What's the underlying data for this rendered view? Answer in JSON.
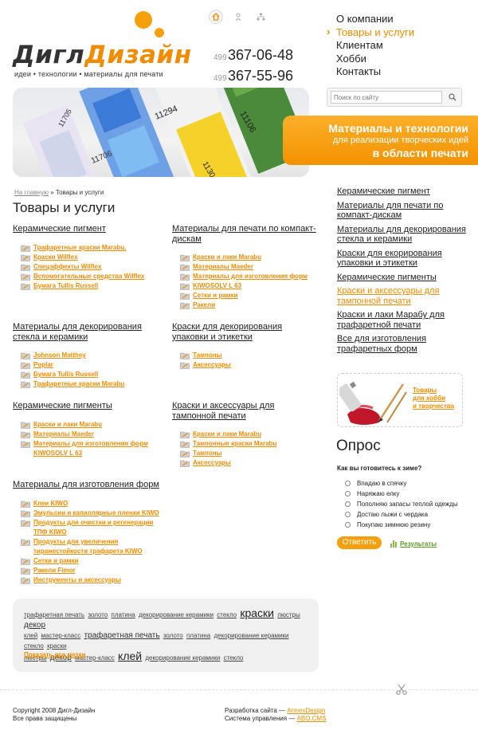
{
  "logo": {
    "part1": "Дигл",
    "part2": "Дизайн",
    "tagline": "идеи • технологии • материалы для печати"
  },
  "top_icons": [
    "home-icon",
    "person-icon",
    "sitemap-icon"
  ],
  "phones": [
    {
      "code": "499",
      "number": "367-06-48"
    },
    {
      "code": "499",
      "number": "367-55-96"
    }
  ],
  "top_nav": [
    {
      "label": "О компании",
      "active": false
    },
    {
      "label": "Товары и услуги",
      "active": true
    },
    {
      "label": "Клиентам",
      "active": false
    },
    {
      "label": "Хобби",
      "active": false
    },
    {
      "label": "Контакты",
      "active": false
    }
  ],
  "search": {
    "placeholder": "Поиск по сайту"
  },
  "banner": {
    "line1": "Материалы и технологии",
    "line2": "для реализации творческих идей",
    "line3": "в области печати",
    "swatch_labels": [
      "11705",
      "11294",
      "11106",
      "11706",
      "1130"
    ]
  },
  "breadcrumb": {
    "home": "На главную",
    "sep": "»",
    "current": "Товары и услуги"
  },
  "page_title": "Товары и услуги",
  "sections": [
    {
      "title": "Керамические пигмент",
      "items": [
        "Трафаретные краски Marabu.",
        "Краски Wilflex",
        "Спецэффекты Wilflex",
        "Вспомогательные средства Wilflex",
        "Бумага Tullis Russell"
      ]
    },
    {
      "title": "Материалы для печати по компакт-дискам",
      "items": [
        "Краски и лаки Marabu",
        "Материалы Maeder",
        "Материалы для изготовления форм",
        "KIWOSOLV L 63",
        "Сетки и рамки",
        "Ракели"
      ]
    },
    {
      "title": "Материалы для декорирования стекла и керамики",
      "items": [
        "Johnson Matthey",
        "Poplar",
        "Бумага Tullis Russell",
        "Трафаретные краски Marabu"
      ]
    },
    {
      "title": "Краски для декорирования упаковки и этикетки",
      "items": [
        "Тампоны",
        "Аксессуары"
      ]
    },
    {
      "title": "Керамические пигменты",
      "items": [
        "Краски и лаки Marabu",
        "Материалы Maeder",
        "Материалы для изготовления форм KIWOSOLV L 63"
      ]
    },
    {
      "title": "Краски и аксессуары для тампонной печати",
      "items": [
        "Краски и лаки Marabu",
        "Тампонные краски Marabu",
        "Тампоны",
        "Аксессуары"
      ]
    },
    {
      "title": "Материалы для изготовления форм",
      "items": [
        "Клеи KIWO",
        "Эмульсии и капиллярные пленки KIWO",
        "Продукты для очистки и регенерации ТПФ KIWO",
        "Продукты для увеличения тиражестойкости трафарета KIWO",
        "Сетки и рамки",
        "Ракели Fimor",
        "Инструменты и аксессуары"
      ]
    }
  ],
  "tags": {
    "row1": [
      {
        "text": "трафаретная печать",
        "size": "sm"
      },
      {
        "text": "золото",
        "size": "sm"
      },
      {
        "text": "платина",
        "size": "sm"
      },
      {
        "text": "декорирование керамики",
        "size": "sm"
      },
      {
        "text": "стекло",
        "size": "sm"
      },
      {
        "text": "краски",
        "size": "lg"
      },
      {
        "text": "люстры",
        "size": "sm"
      },
      {
        "text": "декор",
        "size": "md"
      }
    ],
    "row2": [
      {
        "text": "клей",
        "size": "sm"
      },
      {
        "text": "мастер-класс",
        "size": "sm"
      },
      {
        "text": "трафаретная печать",
        "size": "md"
      },
      {
        "text": "золото",
        "size": "sm"
      },
      {
        "text": "платина",
        "size": "sm"
      },
      {
        "text": "декорирование керамики",
        "size": "sm"
      },
      {
        "text": "стекло",
        "size": "sm"
      },
      {
        "text": "краски",
        "size": "sm"
      }
    ],
    "row3": [
      {
        "text": "люстры",
        "size": "sm"
      },
      {
        "text": "декор",
        "size": "md"
      },
      {
        "text": "мастер-класс",
        "size": "sm"
      },
      {
        "text": "клей",
        "size": "lg"
      },
      {
        "text": "декорирование керамики",
        "size": "sm"
      },
      {
        "text": "стекло",
        "size": "sm"
      }
    ],
    "show_all": "Показать все метки"
  },
  "side_nav": [
    {
      "label": "Керамические пигмент",
      "active": false
    },
    {
      "label": "Материалы для печати по компакт-дискам",
      "active": false
    },
    {
      "label": "Материалы для декорирования стекла и керамики",
      "active": false
    },
    {
      "label": "Краски для екорирования упаковки и этикетки",
      "active": false
    },
    {
      "label": "Керамические пигменты",
      "active": false
    },
    {
      "label": "Краски и аксессуары для тампонной печати",
      "active": true
    },
    {
      "label": "Краски и лаки Марабу для трафаретной печати",
      "active": false
    },
    {
      "label": "Все для изготовления трафаретных форм",
      "active": false
    }
  ],
  "hobby": {
    "line1": "Товары",
    "line2": "для хобби",
    "line3": "и творчества"
  },
  "poll": {
    "title": "Опрос",
    "question": "Как вы готовитесь к зиме?",
    "options": [
      "Впадаю в спячку",
      "Наряжаю елку",
      "Пополняю запасы теплой одежды",
      "Достаю лыжи с чердака",
      "Покупаю зимнюю резину"
    ],
    "vote_label": "Ответить",
    "results_label": "Результаты"
  },
  "footer": {
    "copyright": "Copyright 2008 Дигл-Дизайн",
    "rights": "Все права защищены",
    "dev_label": "Разработка сайта —",
    "dev_link": "ArmexDesign",
    "cms_label": "Система управления —",
    "cms_link": "ABO.CMS"
  },
  "colors": {
    "accent": "#f08c00",
    "accent_light": "#f5a00a",
    "text": "#222222",
    "green": "#5a9a1f"
  }
}
